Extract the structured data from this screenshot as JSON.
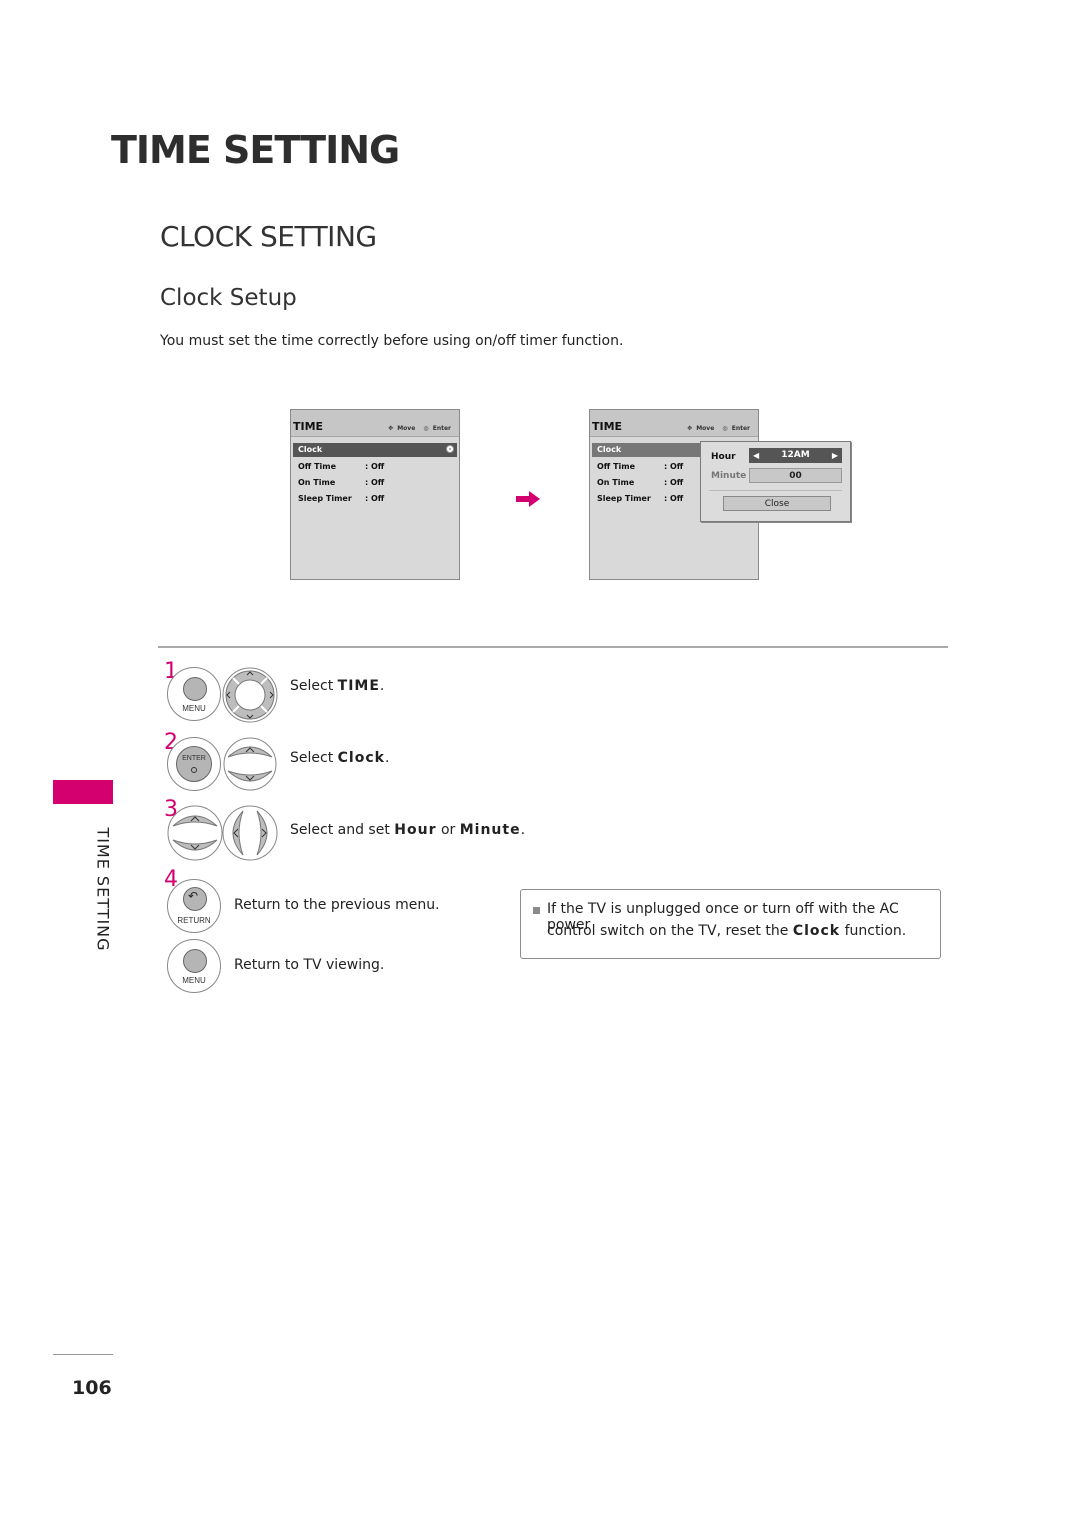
{
  "page": {
    "chapter_title": "TIME SETTING",
    "section_title": "CLOCK SETTING",
    "subsection_title": "Clock Setup",
    "intro": "You must set the time correctly before using on/off timer function.",
    "page_number": "106",
    "side_tab_label": "TIME SETTING",
    "accent_color": "#d4006f"
  },
  "osd_left": {
    "title": "TIME",
    "hint_move": "Move",
    "hint_enter": "Enter",
    "items": [
      {
        "label": "Clock",
        "value": ""
      },
      {
        "label": "Off Time",
        "value": ": Off"
      },
      {
        "label": "On Time",
        "value": ": Off"
      },
      {
        "label": "Sleep Timer",
        "value": ": Off"
      }
    ]
  },
  "osd_right": {
    "title": "TIME",
    "hint_move": "Move",
    "hint_enter": "Enter",
    "items": [
      {
        "label": "Clock",
        "value": ""
      },
      {
        "label": "Off Time",
        "value": ": Off"
      },
      {
        "label": "On Time",
        "value": ": Off"
      },
      {
        "label": "Sleep Timer",
        "value": ": Off"
      }
    ],
    "popup": {
      "hour_label": "Hour",
      "hour_value": "12AM",
      "minute_label": "Minute",
      "minute_value": "00",
      "close_label": "Close"
    }
  },
  "steps": [
    {
      "num": "1",
      "prefix": "Select ",
      "bold": "TIME",
      "suffix": ".",
      "button_label": "MENU"
    },
    {
      "num": "2",
      "prefix": "Select ",
      "bold": "Clock",
      "suffix": ".",
      "button_label": "ENTER"
    },
    {
      "num": "3",
      "prefix": "Select and set ",
      "bold": "Hour",
      "mid": " or ",
      "bold2": "Minute",
      "suffix": "."
    },
    {
      "num": "4",
      "text": "Return to the previous menu.",
      "button_label": "RETURN"
    },
    {
      "text": "Return to TV viewing.",
      "button_label": "MENU"
    }
  ],
  "note": {
    "line1": "If the TV is unplugged once or turn off with the AC power",
    "line2_prefix": "control switch on the TV, reset the ",
    "line2_bold": "Clock",
    "line2_suffix": " function."
  }
}
